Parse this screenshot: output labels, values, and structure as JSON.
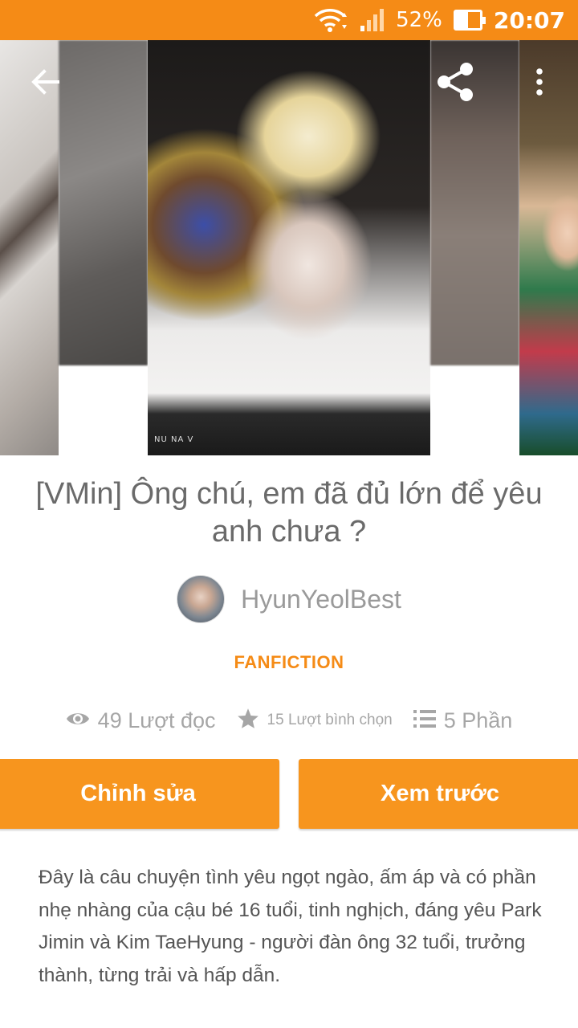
{
  "status_bar": {
    "battery_percent": "52%",
    "battery_level": 0.52,
    "time": "20:07",
    "icons": [
      "wifi-icon",
      "signal-icon",
      "battery-icon"
    ]
  },
  "cover": {
    "caption": "NU NA V"
  },
  "story": {
    "title": "[VMin] Ông chú, em đã đủ lớn để yêu anh chưa ?",
    "author": "HyunYeolBest",
    "category": "FANFICTION"
  },
  "stats": {
    "reads": "49 Lượt đọc",
    "votes": "15 Lượt bình chọn",
    "parts": "5 Phần"
  },
  "buttons": {
    "edit": "Chỉnh sửa",
    "preview": "Xem trước"
  },
  "description": "Đây là câu chuyện tình yêu ngọt ngào, ấm áp và có phần nhẹ nhàng của cậu bé 16 tuổi, tinh nghịch, đáng yêu Park Jimin và Kim TaeHyung - người đàn ông 32 tuổi, trưởng thành, từng trải và hấp dẫn.",
  "colors": {
    "accent": "#f58b16",
    "button": "#f7951e"
  }
}
